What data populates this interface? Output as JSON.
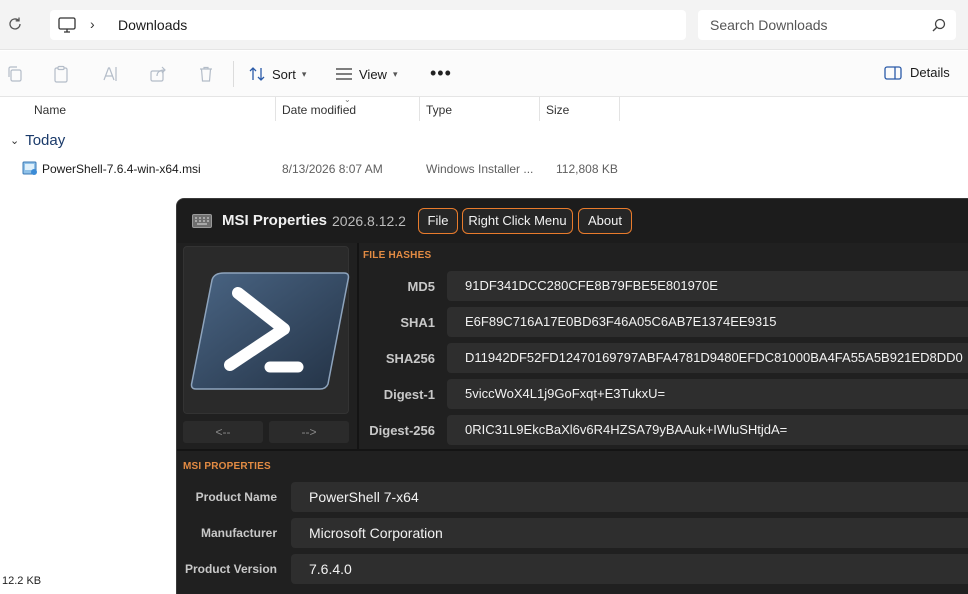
{
  "explorer": {
    "address": {
      "location": "Downloads"
    },
    "search": {
      "placeholder": "Search Downloads"
    },
    "commands": {
      "sort": "Sort",
      "view": "View",
      "more": "•••",
      "details": "Details"
    },
    "columns": {
      "name": "Name",
      "date_modified": "Date modified",
      "type": "Type",
      "size": "Size"
    },
    "group": {
      "label": "Today"
    },
    "files": [
      {
        "name": "PowerShell-7.6.4-win-x64.msi",
        "date": "8/13/2026 8:07 AM",
        "type": "Windows Installer ...",
        "size": "112,808 KB"
      }
    ],
    "status": {
      "selection_size": "12.2 KB"
    }
  },
  "app": {
    "title": "MSI Properties",
    "version": "2026.8.12.2",
    "menu": {
      "file": "File",
      "right_click": "Right Click Menu",
      "about": "About"
    },
    "nav": {
      "prev": "<--",
      "next": "-->"
    },
    "hashes": {
      "section_label": "FILE HASHES",
      "items": [
        {
          "label": "MD5",
          "value": "91DF341DCC280CFE8B79FBE5E801970E"
        },
        {
          "label": "SHA1",
          "value": "E6F89C716A17E0BD63F46A05C6AB7E1374EE9315"
        },
        {
          "label": "SHA256",
          "value": "D11942DF52FD12470169797ABFA4781D9480EFDC81000BA4FA55A5B921ED8DD0"
        },
        {
          "label": "Digest-1",
          "value": "5viccWoX4L1j9GoFxqt+E3TukxU="
        },
        {
          "label": "Digest-256",
          "value": "0RIC31L9EkcBaXl6v6R4HZSA79yBAAuk+IWluSHtjdA="
        }
      ]
    },
    "properties": {
      "section_label": "MSI PROPERTIES",
      "items": [
        {
          "label": "Product Name",
          "value": "PowerShell 7-x64"
        },
        {
          "label": "Manufacturer",
          "value": "Microsoft Corporation"
        },
        {
          "label": "Product Version",
          "value": "7.6.4.0"
        }
      ]
    },
    "colors": {
      "accent": "#e87b2c",
      "background": "#202020",
      "field": "#2e2e2e"
    },
    "icons": {
      "logo": "powershell-icon",
      "title": "keyboard-icon"
    }
  }
}
